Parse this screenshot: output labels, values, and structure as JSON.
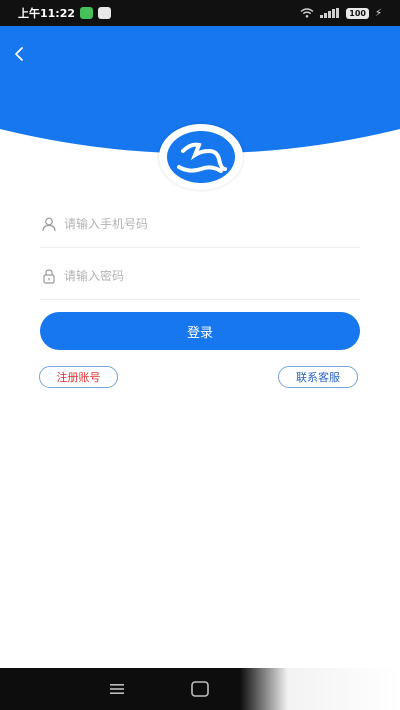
{
  "status_bar": {
    "time": "上午11:22",
    "battery": "100"
  },
  "header": {
    "color": "#1677ef"
  },
  "form": {
    "phone_placeholder": "请输入手机号码",
    "password_placeholder": "请输入密码",
    "login_label": "登录"
  },
  "links": {
    "register_label": "注册账号",
    "service_label": "联系客服"
  },
  "colors": {
    "primary": "#1677ef",
    "register_text": "#e03333",
    "service_text": "#2b66c4",
    "pill_border": "#7aa6d8"
  },
  "icons": {
    "back": "chevron-left-icon",
    "phone": "user-icon",
    "password": "lock-icon",
    "logo": "app-logo"
  }
}
